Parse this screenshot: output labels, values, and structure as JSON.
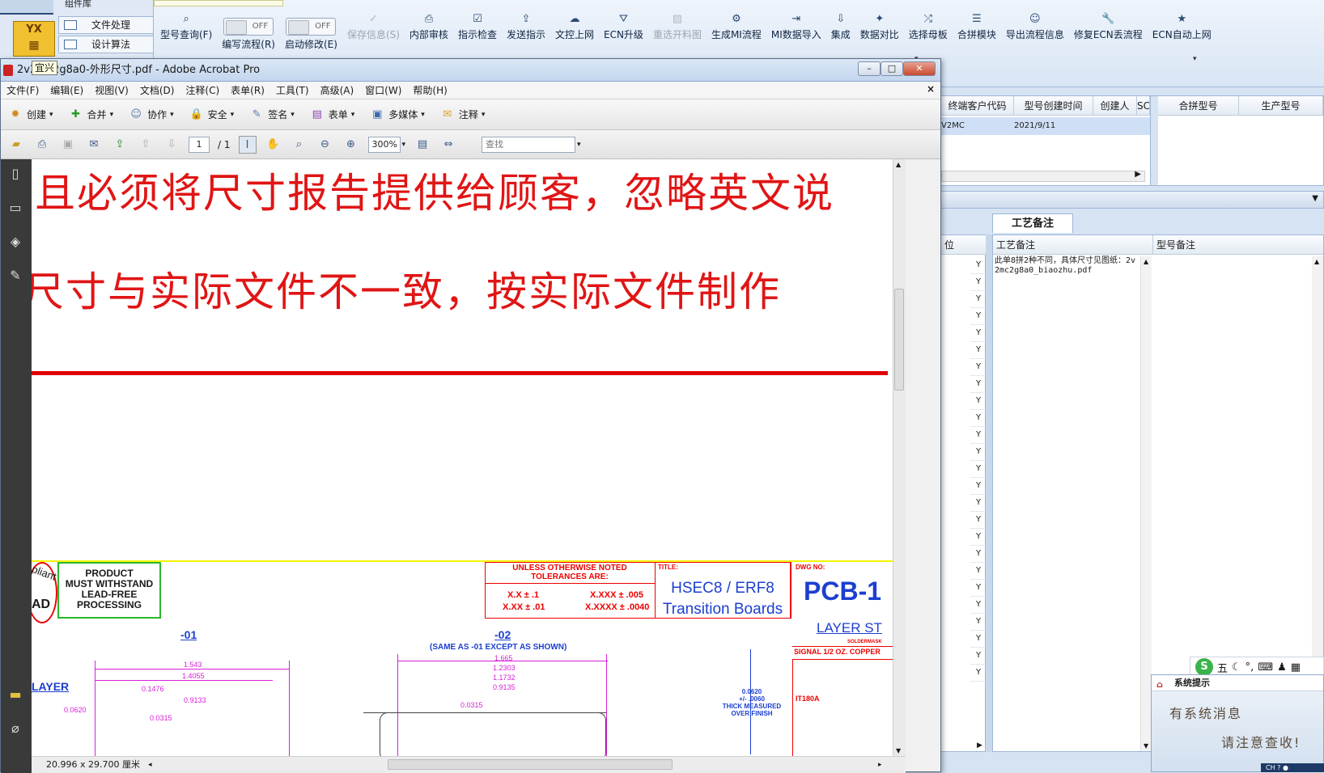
{
  "app": {
    "nav_top_label": "组件库",
    "logo_text": "YX",
    "nav_items": [
      "文件处理",
      "设计算法"
    ],
    "toolbar": [
      {
        "label": "型号查询(F)",
        "icon": "search-icon",
        "enabled": true
      },
      {
        "label": "编写流程(R)",
        "toggle": "OFF",
        "enabled": true
      },
      {
        "label": "启动修改(E)",
        "toggle": "OFF",
        "enabled": true
      },
      {
        "label": "保存信息(S)",
        "icon": "check-icon",
        "enabled": false
      },
      {
        "label": "内部审核",
        "icon": "print-icon",
        "enabled": true
      },
      {
        "label": "指示检查",
        "icon": "checkbox-icon",
        "enabled": true
      },
      {
        "label": "发送指示",
        "icon": "upload-icon",
        "enabled": true
      },
      {
        "label": "文控上网",
        "icon": "cloud-upload-icon",
        "enabled": true
      },
      {
        "label": "ECN升级",
        "icon": "road-icon",
        "enabled": true
      },
      {
        "label": "重选开料图",
        "icon": "image-icon",
        "enabled": false
      },
      {
        "label": "生成MI流程",
        "icon": "cogs-icon",
        "enabled": true
      },
      {
        "label": "MI数据导入",
        "icon": "sign-in-icon",
        "enabled": true
      },
      {
        "label": "集成",
        "icon": "download-icon",
        "enabled": true
      },
      {
        "label": "数据对比",
        "icon": "magic-icon",
        "enabled": true
      },
      {
        "label": "选择母板",
        "icon": "random-icon",
        "enabled": true
      },
      {
        "label": "合拼模块",
        "icon": "list-icon",
        "enabled": true
      },
      {
        "label": "导出流程信息",
        "icon": "smile-icon",
        "enabled": true
      },
      {
        "label": "修复ECN丢流程",
        "icon": "wrench-icon",
        "enabled": true
      },
      {
        "label": "ECN自动上网",
        "icon": "star-icon",
        "enabled": true
      }
    ],
    "grid_top": {
      "headers": [
        "终端客户代码",
        "型号创建时间",
        "创建人",
        "SC",
        "合拼型号",
        "生产型号"
      ],
      "row": {
        "customer_code": "V2MC",
        "created": "2021/9/11"
      }
    },
    "col_header_partial": "位",
    "y_values": [
      "Y",
      "Y",
      "Y",
      "Y",
      "Y",
      "Y",
      "Y",
      "Y",
      "Y",
      "Y",
      "Y",
      "Y",
      "Y",
      "Y",
      "Y",
      "Y",
      "Y",
      "Y",
      "Y",
      "Y",
      "Y",
      "Y",
      "Y",
      "Y",
      "Y"
    ],
    "craft_tab": "工艺备注",
    "craft_header": "工艺备注",
    "model_note_header": "型号备注",
    "craft_note_text": "此单8拼2种不同，具体尺寸见图纸：2v2mc2g8a0_biaozhu.pdf",
    "sysmsg": {
      "title": "系统提示",
      "line1": "有系统消息",
      "line2": "请注意查收!"
    },
    "ime": {
      "label": "五",
      "lang": "CH"
    }
  },
  "acrobat": {
    "title": "2v2mc2g8a0-外形尺寸.pdf - Adobe Acrobat Pro",
    "tooltip": "宜兴",
    "menu": [
      "文件(F)",
      "编辑(E)",
      "视图(V)",
      "文档(D)",
      "注释(C)",
      "表单(R)",
      "工具(T)",
      "高级(A)",
      "窗口(W)",
      "帮助(H)"
    ],
    "tools": [
      "创建",
      "合并",
      "协作",
      "安全",
      "签名",
      "表单",
      "多媒体",
      "注释"
    ],
    "page_current": "1",
    "page_total": "/ 1",
    "zoom": "300%",
    "find_placeholder": "查找",
    "page_size": "20.996 x 29.700 厘米"
  },
  "document": {
    "line1": "且必须将尺寸报告提供给顾客，忽略英文说",
    "line2": "尺寸与实际文件不一致，按实际文件制作",
    "compliant": "pliant",
    "lead": "AD",
    "product_note": "PRODUCT\nMUST WITHSTAND\nLEAD-FREE\nPROCESSING",
    "tol_header": "UNLESS OTHERWISE NOTED\nTOLERANCES ARE:",
    "tol_a": "X.X ± .1",
    "tol_b": "X.XX ± .01",
    "tol_c": "X.XXX ± .005",
    "tol_d": "X.XXXX ± .0040",
    "title_label": "TITLE:",
    "title_value": "HSEC8 / ERF8\nTransition Boards",
    "dwg_label": "DWG NO:",
    "dwg_value": "PCB-1",
    "layer_title": "LAYER ST",
    "soldermask": "SOLDERMASK",
    "signal": "SIGNAL 1/2 OZ. COPPER",
    "it_label": "IT180A",
    "thick": "0.0620\n+/- .0060\nTHICK MEASURED\nOVER FINISH",
    "dash01": "-01",
    "dash02": "-02",
    "same_as": "(SAME AS -01 EXCEPT AS SHOWN)",
    "layer_word": "LAYER",
    "dims01": [
      "1.543",
      "1.4055",
      "0.1476",
      "0.9133",
      "0.0315",
      "0.0620"
    ],
    "dims02": [
      "1.665",
      "1.2303",
      "1.1732",
      "0.9135",
      "0.0315"
    ]
  }
}
